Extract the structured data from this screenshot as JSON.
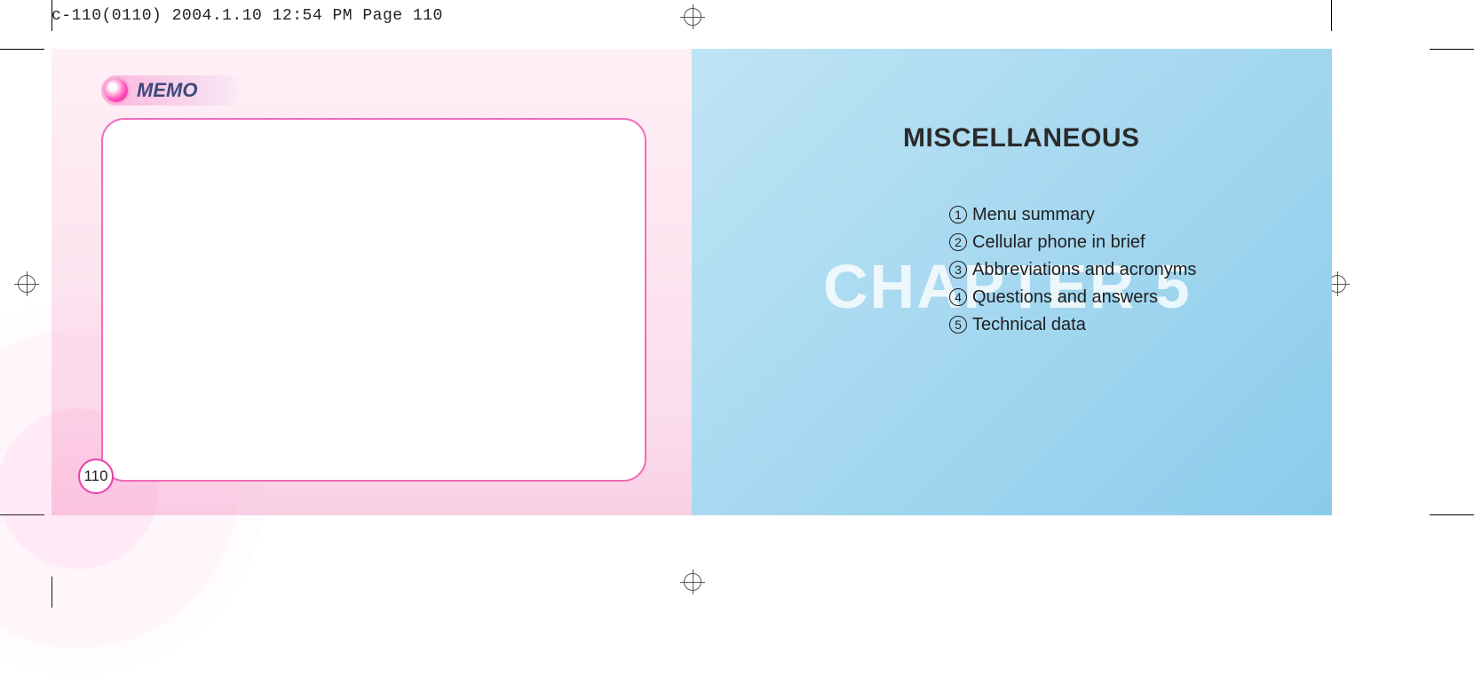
{
  "print_meta": "c-110(0110)  2004.1.10  12:54 PM  Page 110",
  "left_page": {
    "tab_label": "MEMO",
    "page_number": "110"
  },
  "right_page": {
    "title": "MISCELLANEOUS",
    "chapter_watermark": "CHAPTER 5",
    "toc": [
      {
        "num": "1",
        "label": "Menu summary"
      },
      {
        "num": "2",
        "label": "Cellular phone in brief"
      },
      {
        "num": "3",
        "label": "Abbreviations and acronyms"
      },
      {
        "num": "4",
        "label": "Questions and answers"
      },
      {
        "num": "5",
        "label": "Technical data"
      }
    ]
  }
}
